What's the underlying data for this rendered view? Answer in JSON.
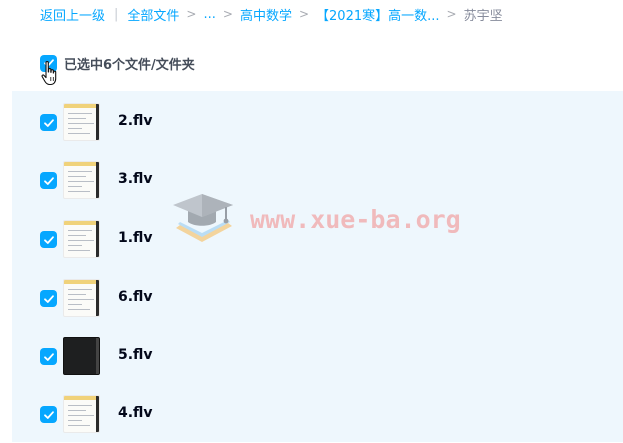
{
  "breadcrumb": {
    "back_label": "返回上一级",
    "items": [
      "全部文件",
      "...",
      "高中数学",
      "【2021寒】高一数..."
    ],
    "separator": ">",
    "current": "苏宇坚"
  },
  "selection": {
    "label": "已选中6个文件/文件夹",
    "checked": true
  },
  "files": [
    {
      "name": "2.flv",
      "checked": true,
      "thumb": "light"
    },
    {
      "name": "3.flv",
      "checked": true,
      "thumb": "light"
    },
    {
      "name": "1.flv",
      "checked": true,
      "thumb": "light"
    },
    {
      "name": "6.flv",
      "checked": true,
      "thumb": "light"
    },
    {
      "name": "5.flv",
      "checked": true,
      "thumb": "dark"
    },
    {
      "name": "4.flv",
      "checked": true,
      "thumb": "light"
    }
  ],
  "watermark": {
    "text": "www.xue-ba.org",
    "icon": "graduation-cap-icon"
  },
  "colors": {
    "accent": "#06a7ff",
    "selected_row_bg": "#eef7fd",
    "watermark": "#f29a9a"
  }
}
